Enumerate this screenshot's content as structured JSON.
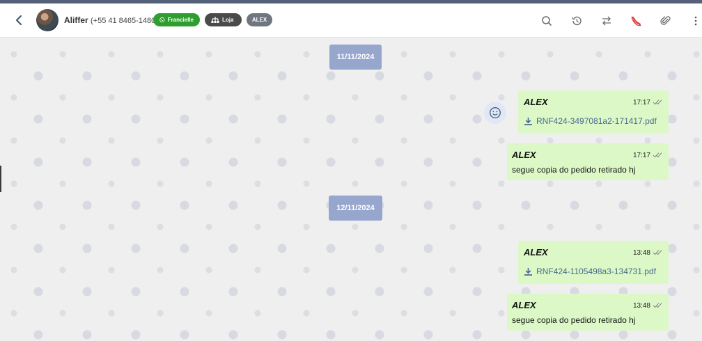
{
  "header": {
    "contact_name": "Aliffer",
    "contact_phone": "(+55 41 8465-1480)",
    "tags": {
      "whatsapp": "Francielle",
      "store": "Loja",
      "user": "ALEX"
    },
    "icons": [
      "back-icon",
      "search-icon",
      "history-icon",
      "transfer-icon",
      "phone-off-icon",
      "attachment-icon",
      "more-vertical-icon"
    ]
  },
  "colors": {
    "bubble": "#dcf8c6",
    "date_pill": "#97a6cd",
    "whatsapp_tag": "#2e9e2e",
    "store_tag": "#4a4a4a",
    "user_tag": "#6f7680",
    "phone_off": "#d93a3a"
  },
  "messages": [
    {
      "date": "11/11/2024"
    },
    {
      "sender": "ALEX",
      "time": "17:17",
      "file": "RNF424-3497081a2-171417.pdf"
    },
    {
      "sender": "ALEX",
      "time": "17:17",
      "text": "segue copia do pedido retirado hj"
    },
    {
      "date": "12/11/2024"
    },
    {
      "sender": "ALEX",
      "time": "13:48",
      "file": "RNF424-1105498a3-134731.pdf"
    },
    {
      "sender": "ALEX",
      "time": "13:48",
      "text": "segue copia do pedido retirado hj"
    }
  ]
}
